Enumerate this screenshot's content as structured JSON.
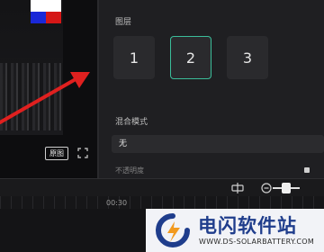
{
  "preview": {
    "original_label": "原图",
    "fullscreen_icon": "fullscreen-icon"
  },
  "panel": {
    "layer_label": "图层",
    "layers": [
      "1",
      "2",
      "3"
    ],
    "selected_layer": "2",
    "blend_label": "混合模式",
    "blend_value": "无",
    "opacity_label": "不透明度"
  },
  "timeline": {
    "time_label": "00:30",
    "icons": [
      "snap-icon",
      "zoom-out-icon"
    ]
  },
  "watermark": {
    "title": "电闪软件站",
    "url": "WWW.DS-SOLARBATTERY.COM"
  },
  "colors": {
    "accent": "#3bbd9a",
    "arrow": "#e0201f",
    "watermark_blue": "#1f3d8c",
    "watermark_orange": "#f29a1f"
  }
}
